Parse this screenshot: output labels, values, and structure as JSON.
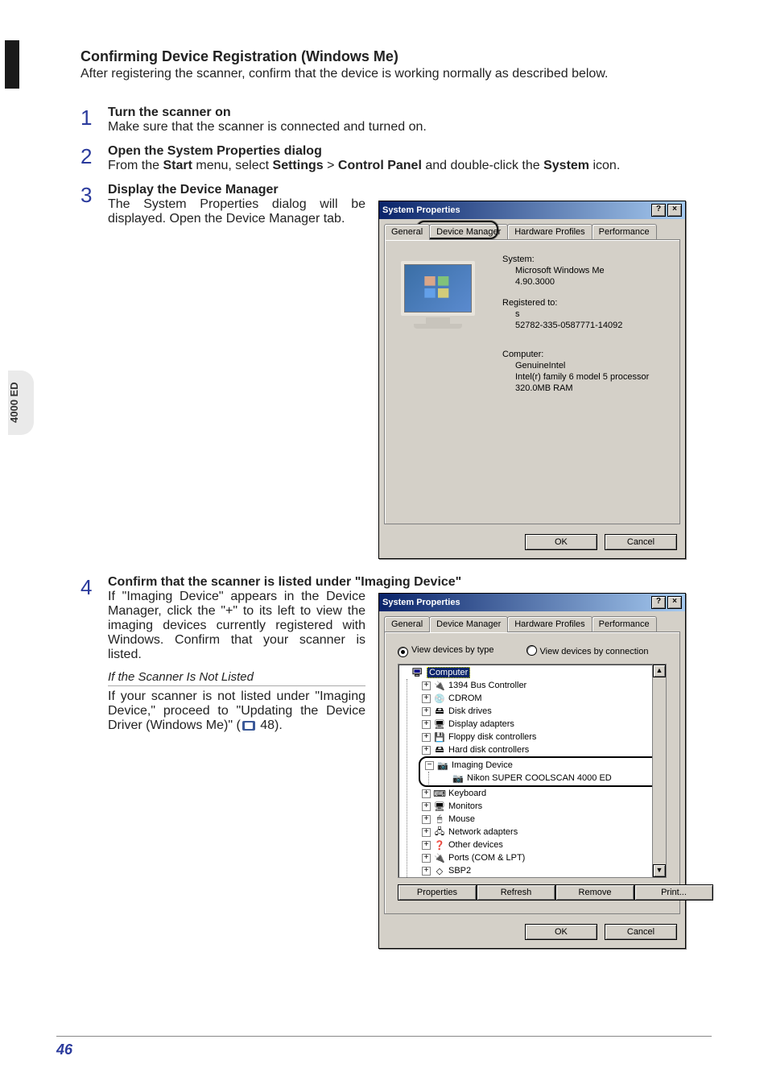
{
  "side_label": "4000 ED",
  "page_number": "46",
  "heading": "Confirming Device Registration (Windows Me)",
  "intro": "After registering the scanner, confirm that the device is working normally as described below.",
  "steps": {
    "s1": {
      "num": "1",
      "title": "Turn the scanner on",
      "desc": "Make sure that the scanner is connected and turned on."
    },
    "s2": {
      "num": "2",
      "title": "Open the System Properties dialog",
      "desc_pre": "From the ",
      "b1": "Start",
      "mid1": " menu, select ",
      "b2": "Settings",
      "gt": " > ",
      "b3": "Control Panel",
      "mid2": " and double-click the ",
      "b4": "System",
      "desc_post": " icon."
    },
    "s3": {
      "num": "3",
      "title": "Display the Device Manager",
      "desc": "The System Properties dialog will be displayed.  Open the Device Manager tab."
    },
    "s4": {
      "num": "4",
      "title": "Confirm that the scanner is listed under \"Imaging Device\"",
      "desc": "If \"Imaging Device\" appears in the Device Manager, click the \"+\" to its left to view the imaging devices currently registered with Windows.  Confirm that your scanner is listed.",
      "subhead": "If the Scanner Is Not Listed",
      "sub_desc_pre": "If your scanner is not listed under \"Imaging Device,\" proceed to \"Updating the Device Driver (Windows Me)\" (",
      "sub_desc_post": " 48)."
    }
  },
  "dlg1": {
    "title": "System Properties",
    "tabs": [
      "General",
      "Device Manager",
      "Hardware Profiles",
      "Performance"
    ],
    "callout_tab": "Device Manager",
    "system_label": "System:",
    "system_lines": [
      "Microsoft Windows Me",
      "4.90.3000"
    ],
    "registered_label": "Registered to:",
    "registered_lines": [
      "s",
      "52782-335-0587771-14092"
    ],
    "computer_label": "Computer:",
    "computer_lines": [
      "GenuineIntel",
      "Intel(r) family 6 model 5 processor",
      "320.0MB RAM"
    ],
    "ok": "OK",
    "cancel": "Cancel"
  },
  "dlg2": {
    "title": "System Properties",
    "tabs": [
      "General",
      "Device Manager",
      "Hardware Profiles",
      "Performance"
    ],
    "view_type": "View devices by type",
    "view_conn": "View devices by connection",
    "tree_root": "Computer",
    "nodes": [
      "1394 Bus Controller",
      "CDROM",
      "Disk drives",
      "Display adapters",
      "Floppy disk controllers",
      "Hard disk controllers"
    ],
    "imaging": "Imaging Device",
    "imaging_child": "Nikon SUPER COOLSCAN 4000 ED",
    "nodes2": [
      "Keyboard",
      "Monitors",
      "Mouse",
      "Network adapters",
      "Other devices",
      "Ports (COM & LPT)",
      "SBP2"
    ],
    "btns": [
      "Properties",
      "Refresh",
      "Remove",
      "Print..."
    ],
    "ok": "OK",
    "cancel": "Cancel"
  }
}
